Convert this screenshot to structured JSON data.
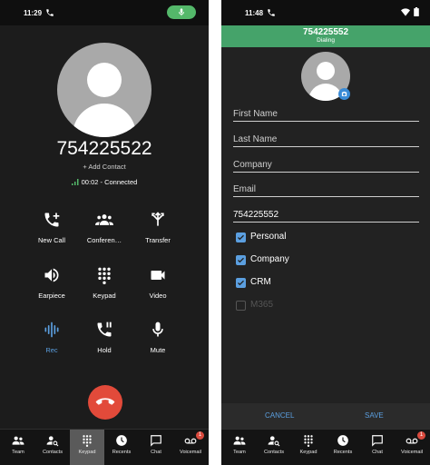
{
  "left": {
    "status_time": "11:29",
    "number": "754225522",
    "add_contact": "+ Add Contact",
    "call_status": "00:02 - Connected",
    "controls": [
      {
        "label": "New Call",
        "icon": "add-call-icon"
      },
      {
        "label": "Conferen…",
        "icon": "conference-icon"
      },
      {
        "label": "Transfer",
        "icon": "transfer-icon"
      },
      {
        "label": "Earpiece",
        "icon": "speaker-icon"
      },
      {
        "label": "Keypad",
        "icon": "dialpad-icon"
      },
      {
        "label": "Video",
        "icon": "video-icon"
      },
      {
        "label": "Rec",
        "icon": "record-icon",
        "active": true
      },
      {
        "label": "Hold",
        "icon": "hold-icon"
      },
      {
        "label": "Mute",
        "icon": "mic-icon"
      }
    ],
    "nav": [
      "Team",
      "Contacts",
      "Keypad",
      "Recents",
      "Chat",
      "Voicemail"
    ],
    "selected_nav": "Keypad",
    "voicemail_badge": "1"
  },
  "right": {
    "status_time": "11:48",
    "header_number": "754225552",
    "header_status": "Dialing",
    "fields": {
      "first_name": "First Name",
      "last_name": "Last Name",
      "company": "Company",
      "email": "Email",
      "phone_value": "754225552"
    },
    "checks": [
      {
        "label": "Personal",
        "checked": true
      },
      {
        "label": "Company",
        "checked": true
      },
      {
        "label": "CRM",
        "checked": true
      },
      {
        "label": "M365",
        "checked": false,
        "disabled": true
      }
    ],
    "cancel": "CANCEL",
    "save": "SAVE",
    "nav": [
      "Team",
      "Contacts",
      "Keypad",
      "Recents",
      "Chat",
      "Voicemail"
    ],
    "voicemail_badge": "1"
  },
  "colors": {
    "accent_blue": "#5b9fe0",
    "dialing_green": "#45a36a",
    "hangup_red": "#e24a3a",
    "badge_red": "#d94a3e"
  }
}
